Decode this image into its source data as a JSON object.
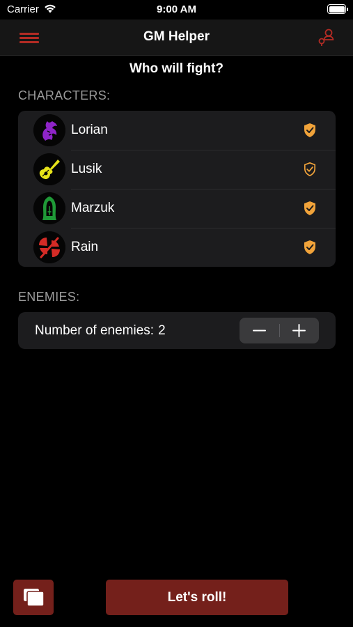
{
  "status_bar": {
    "carrier": "Carrier",
    "time": "9:00 AM"
  },
  "nav": {
    "title": "GM Helper",
    "menu_icon": "hamburger-menu-icon",
    "user_icon": "user-icon"
  },
  "question": "Who will fight?",
  "characters": {
    "header": "CHARACTERS:",
    "items": [
      {
        "name": "Lorian",
        "icon": "purple-beast-icon",
        "color": "#8e24c8",
        "selected": true
      },
      {
        "name": "Lusik",
        "icon": "yellow-guitar-icon",
        "color": "#e7e319",
        "selected": true
      },
      {
        "name": "Marzuk",
        "icon": "green-hooded-figure-icon",
        "color": "#1f9a37",
        "selected": true
      },
      {
        "name": "Rain",
        "icon": "red-double-axe-icon",
        "color": "#d42b26",
        "selected": true
      }
    ],
    "check_color": "#f1a33a"
  },
  "enemies": {
    "header": "ENEMIES:",
    "label": "Number of enemies:",
    "count": "2"
  },
  "bottom": {
    "cards_icon": "cards-icon",
    "roll_label": "Let's roll!",
    "accent": "#74201b"
  },
  "accent": "#b22b24"
}
